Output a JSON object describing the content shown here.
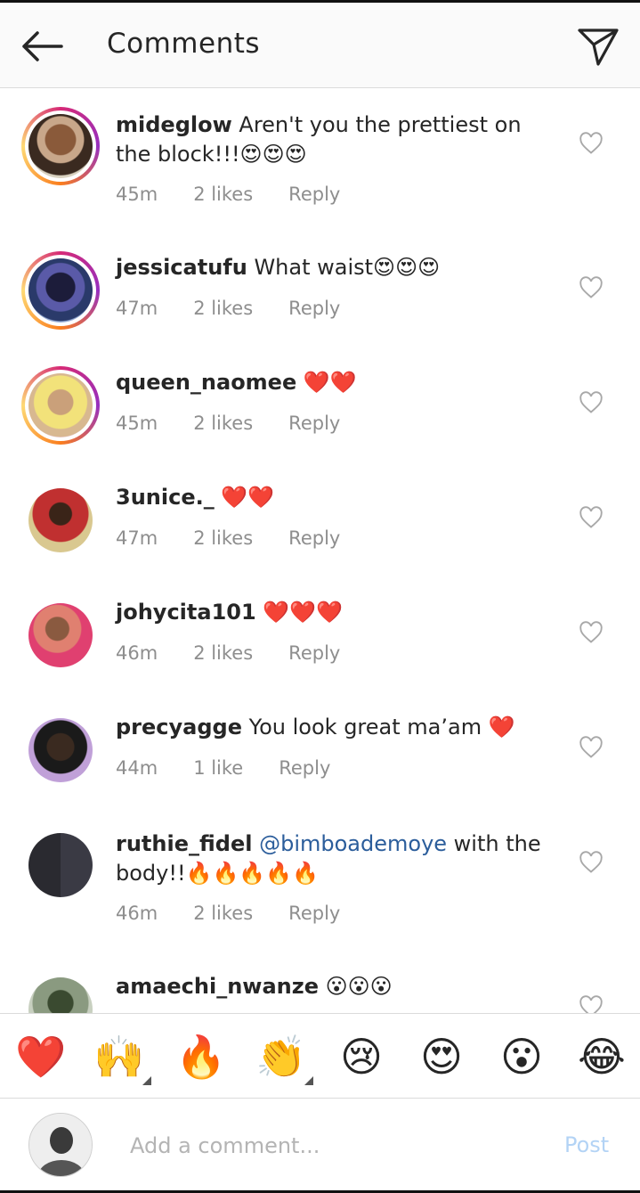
{
  "header": {
    "title": "Comments",
    "back_icon": "arrow-left-icon",
    "send_icon": "paper-plane-icon"
  },
  "comments": [
    {
      "username": "mideglow",
      "text": "Aren't you the prettiest on the block!!!😍😍😍",
      "mention": "",
      "time": "45m",
      "likes": "2 likes",
      "reply": "Reply",
      "ring": true
    },
    {
      "username": "jessicatufu",
      "text": "What waist😍😍😍",
      "mention": "",
      "time": "47m",
      "likes": "2 likes",
      "reply": "Reply",
      "ring": true
    },
    {
      "username": "queen_naomee",
      "text": "❤️❤️",
      "mention": "",
      "time": "45m",
      "likes": "2 likes",
      "reply": "Reply",
      "ring": true
    },
    {
      "username": "3unice._",
      "text": "❤️❤️",
      "mention": "",
      "time": "47m",
      "likes": "2 likes",
      "reply": "Reply",
      "ring": false
    },
    {
      "username": "johycita101",
      "text": "❤️❤️❤️",
      "mention": "",
      "time": "46m",
      "likes": "2 likes",
      "reply": "Reply",
      "ring": false
    },
    {
      "username": "precyagge",
      "text": "You look great ma’am ❤️",
      "mention": "",
      "time": "44m",
      "likes": "1 like",
      "reply": "Reply",
      "ring": false
    },
    {
      "username": "ruthie_fidel",
      "text": " with the body!!🔥🔥🔥🔥🔥",
      "mention": "@bimboademoye",
      "time": "46m",
      "likes": "2 likes",
      "reply": "Reply",
      "ring": false
    },
    {
      "username": "amaechi_nwanze",
      "text": "😮😮😮",
      "mention": "",
      "time": "",
      "likes": "",
      "reply": "",
      "ring": false
    }
  ],
  "reactions": [
    {
      "emoji": "❤️",
      "name": "red-heart-emoji"
    },
    {
      "emoji": "🙌",
      "name": "raising-hands-emoji"
    },
    {
      "emoji": "🔥",
      "name": "fire-emoji"
    },
    {
      "emoji": "👏",
      "name": "clapping-hands-emoji"
    },
    {
      "emoji": "😢",
      "name": "crying-face-emoji"
    },
    {
      "emoji": "😍",
      "name": "heart-eyes-emoji"
    },
    {
      "emoji": "😮",
      "name": "surprised-face-emoji"
    },
    {
      "emoji": "😂",
      "name": "tears-of-joy-emoji"
    }
  ],
  "composer": {
    "placeholder": "Add a comment...",
    "post_label": "Post"
  },
  "colors": {
    "mention": "#2b5d9b",
    "post_disabled": "#b3d3f5",
    "meta": "#8e8e8e",
    "ring_start": "#d62976",
    "ring_end": "#feda75"
  }
}
